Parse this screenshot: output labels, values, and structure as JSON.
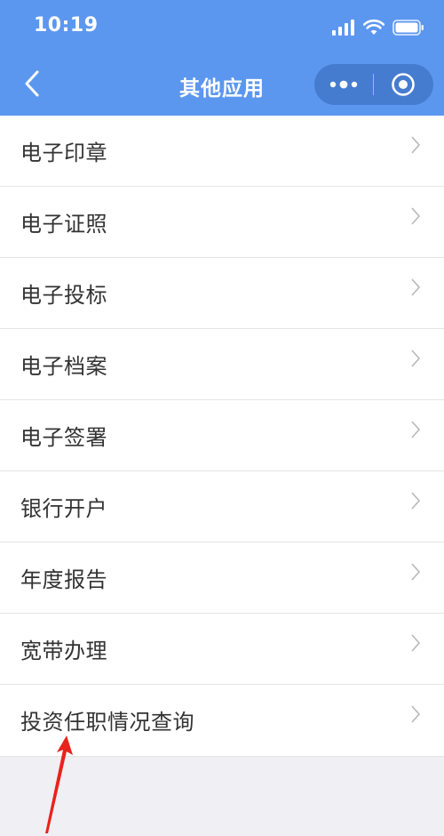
{
  "status_bar": {
    "time": "10:19",
    "icons": [
      "signal-icon",
      "wifi-icon",
      "battery-icon"
    ]
  },
  "nav": {
    "back_icon": "chevron-left-icon",
    "title": "其他应用",
    "more_icon": "more-dots-icon",
    "close_icon": "close-target-icon"
  },
  "menu": {
    "items": [
      {
        "label": "电子印章"
      },
      {
        "label": "电子证照"
      },
      {
        "label": "电子投标"
      },
      {
        "label": "电子档案"
      },
      {
        "label": "电子签署"
      },
      {
        "label": "银行开户"
      },
      {
        "label": "年度报告"
      },
      {
        "label": "宽带办理"
      },
      {
        "label": "投资任职情况查询"
      }
    ]
  },
  "colors": {
    "header": "#5c97ef",
    "background": "#efeff4",
    "annotation": "#e8231c"
  }
}
